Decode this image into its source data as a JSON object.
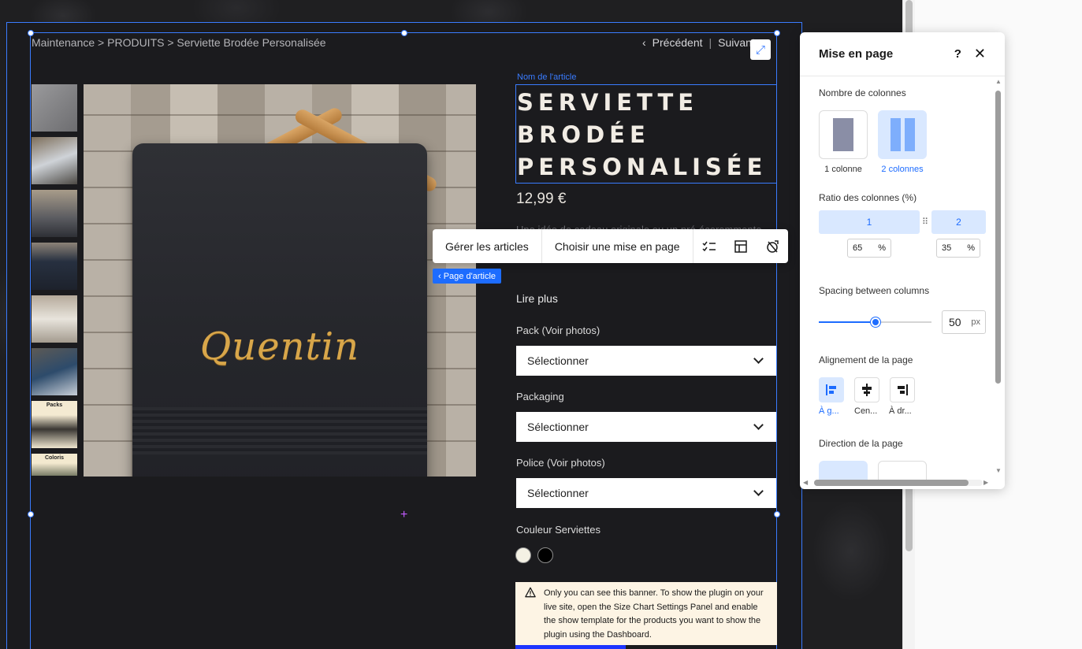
{
  "breadcrumb": "Maintenance > PRODUITS > Serviette Brodée Personalisée",
  "nav": {
    "previous": "Précédent",
    "next": "Suivant"
  },
  "product": {
    "name_label": "Nom de l'article",
    "title": "SERVIETTE BRODÉE PERSONALISÉE",
    "price": "12,99 €",
    "description": "Une idée de cadeau originale ou un pré-écoremmente, sélectionnez la couleur ainsi que les différents…",
    "read_more": "Lire plus",
    "embroidery_text": "Quentin"
  },
  "gallery": {
    "thumb7_label": "Packs",
    "thumb8_label": "Coloris"
  },
  "options": [
    {
      "label": "Pack (Voir photos)",
      "value": "Sélectionner"
    },
    {
      "label": "Packaging",
      "value": "Sélectionner"
    },
    {
      "label": "Police (Voir photos)",
      "value": "Sélectionner"
    }
  ],
  "color_label": "Couleur Serviettes",
  "colors": [
    "#f4f1e4",
    "#000000"
  ],
  "banner_text": "Only you can see this banner. To show the plugin on your live site, open the Size Chart Settings Panel and enable the show template for the products you want to show the plugin using the Dashboard.",
  "toolbar": {
    "manage": "Gérer les articles",
    "layout": "Choisir une mise en page",
    "icons": [
      "checklist-icon",
      "layout-icon",
      "design-icon"
    ]
  },
  "tag": "‹ Page d'article",
  "panel": {
    "title": "Mise en page",
    "help": "?",
    "columns_label": "Nombre de colonnes",
    "col1": "1 colonne",
    "col2": "2 colonnes",
    "ratio_label": "Ratio des colonnes (%)",
    "ratio_col1": "1",
    "ratio_col2": "2",
    "ratio_value1": "65",
    "ratio_value2": "35",
    "percent": "%",
    "spacing_label": "Spacing between columns",
    "spacing_value": "50",
    "spacing_unit": "px",
    "spacing_fraction": 0.5,
    "align_label": "Alignement de la page",
    "align_left": "À g...",
    "align_center": "Cen...",
    "align_right": "À dr...",
    "direction_label": "Direction de la page"
  },
  "colors_ui": {
    "accent": "#1d6cff",
    "selection": "#3a7cff",
    "panel_selected": "#d9e8ff"
  }
}
